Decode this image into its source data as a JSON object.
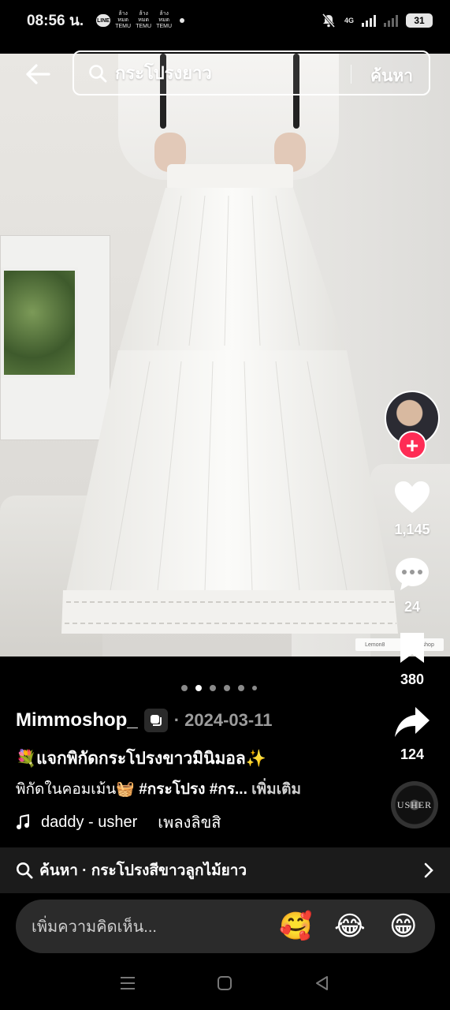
{
  "status_bar": {
    "time": "08:56 น.",
    "notif_line": "LINE",
    "notif_temu": [
      "ล้างหมด TEMU",
      "ล้างหมด TEMU",
      "ล้างหมด TEMU"
    ],
    "network": "4G",
    "battery": "31"
  },
  "search": {
    "query": "กระโปรงยาว",
    "button": "ค้นหา"
  },
  "watermark": {
    "left": "Lemon8",
    "right": "mimmoshop"
  },
  "rail": {
    "likes": "1,145",
    "comments": "24",
    "saves": "380",
    "shares": "124",
    "follow_symbol": "+",
    "disc_label": "USHER"
  },
  "pagination": {
    "total": 6,
    "active": 2
  },
  "post": {
    "author": "Mimmoshop_",
    "date": "· 2024-03-11",
    "title": "💐แจกพิกัดกระโปรงขาวมินิมอล✨",
    "text_prefix": "พิกัดในคอมเม้น🧺 ",
    "tags": "#กระโปรง #กร...",
    "more": "เพิ่มเติม"
  },
  "music": {
    "song": "daddy - usher",
    "lyrics": "เพลงลิขสิ"
  },
  "suggestion": {
    "text": "ค้นหา · กระโปรงสีขาวลูกไม้ยาว"
  },
  "comment": {
    "placeholder": "เพิ่มความคิดเห็น...",
    "emojis": [
      "🥰",
      "😂",
      "😁"
    ]
  },
  "colors": {
    "follow": "#fe2c55",
    "background": "#000000",
    "suggest_bar": "#1b1b1b",
    "comment_bar": "#2b2b2b"
  },
  "icons": [
    "back-arrow-icon",
    "search-icon",
    "heart-icon",
    "comment-icon",
    "bookmark-icon",
    "share-icon",
    "music-note-icon",
    "chevron-right-icon",
    "recents-icon",
    "home-icon",
    "back-triangle-icon"
  ]
}
